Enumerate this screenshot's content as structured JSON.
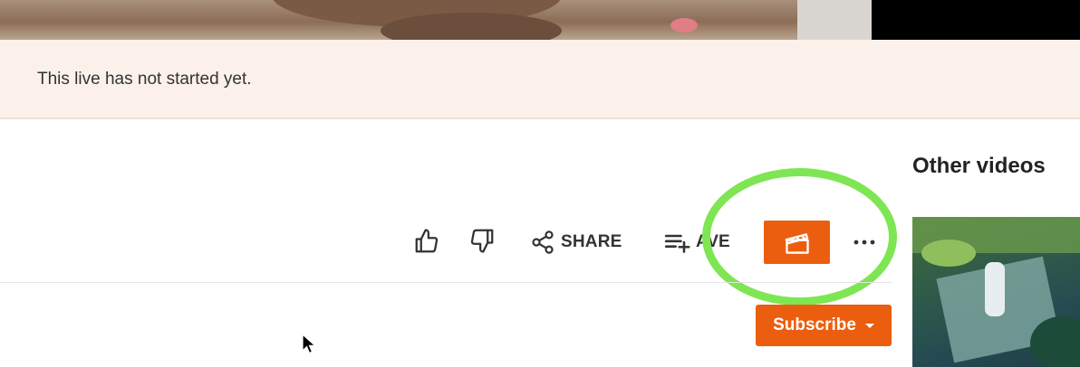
{
  "notice": {
    "text": "This live has not started yet."
  },
  "actions": {
    "like_icon": "thumbs-up-icon",
    "dislike_icon": "thumbs-down-icon",
    "share_label": "SHARE",
    "save_label": "AVE",
    "clip_icon": "clapperboard-icon",
    "more_icon": "more-horizontal-icon"
  },
  "subscribe": {
    "label": "Subscribe"
  },
  "sidebar": {
    "title": "Other videos"
  },
  "colors": {
    "accent": "#ec5e0f",
    "notice_bg": "#fcf1ea",
    "highlight": "#7ee652"
  }
}
